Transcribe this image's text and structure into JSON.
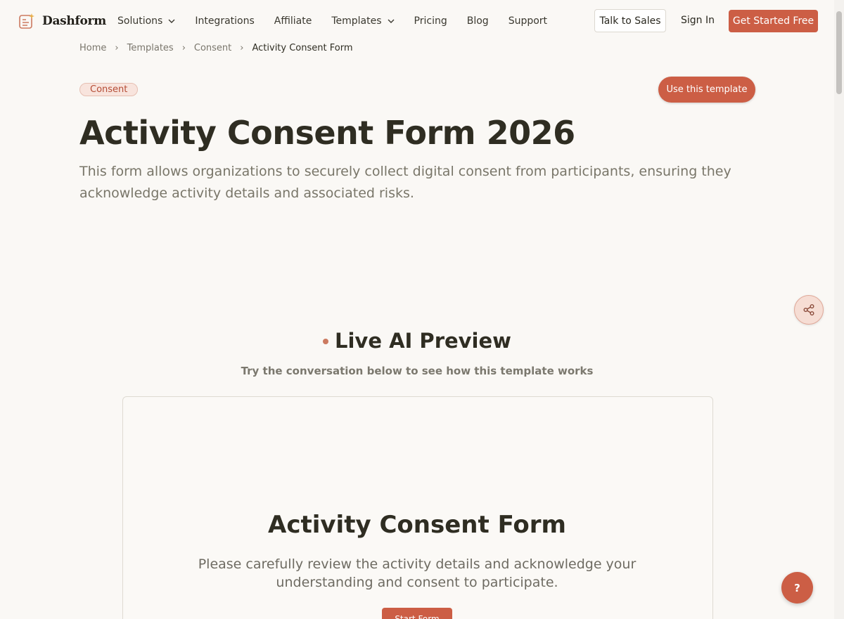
{
  "nav": {
    "brand": "Dashform",
    "links": [
      {
        "label": "Solutions",
        "dropdown": true
      },
      {
        "label": "Integrations",
        "dropdown": false
      },
      {
        "label": "Affiliate",
        "dropdown": false
      },
      {
        "label": "Templates",
        "dropdown": true
      },
      {
        "label": "Pricing",
        "dropdown": false
      },
      {
        "label": "Blog",
        "dropdown": false
      },
      {
        "label": "Support",
        "dropdown": false
      }
    ],
    "talk_to_sales": "Talk to Sales",
    "sign_in": "Sign In",
    "get_started": "Get Started Free"
  },
  "breadcrumb": {
    "items": [
      "Home",
      "Templates",
      "Consent"
    ],
    "current": "Activity Consent Form"
  },
  "hero": {
    "tag": "Consent",
    "use_template": "Use this template",
    "title": "Activity Consent Form 2026",
    "description": "This form allows organizations to securely collect digital consent from participants, ensuring they acknowledge activity details and associated risks."
  },
  "preview": {
    "title": "Live AI Preview",
    "subtitle": "Try the conversation below to see how this template works",
    "card_title": "Activity Consent Form",
    "card_description": "Please carefully review the activity details and acknowledge your understanding and consent to participate.",
    "start_button": "Start Form"
  },
  "help_label": "?",
  "colors": {
    "accent": "#cc5e45",
    "background": "#faf8f5",
    "text": "#2f2d22",
    "muted": "#797669"
  }
}
